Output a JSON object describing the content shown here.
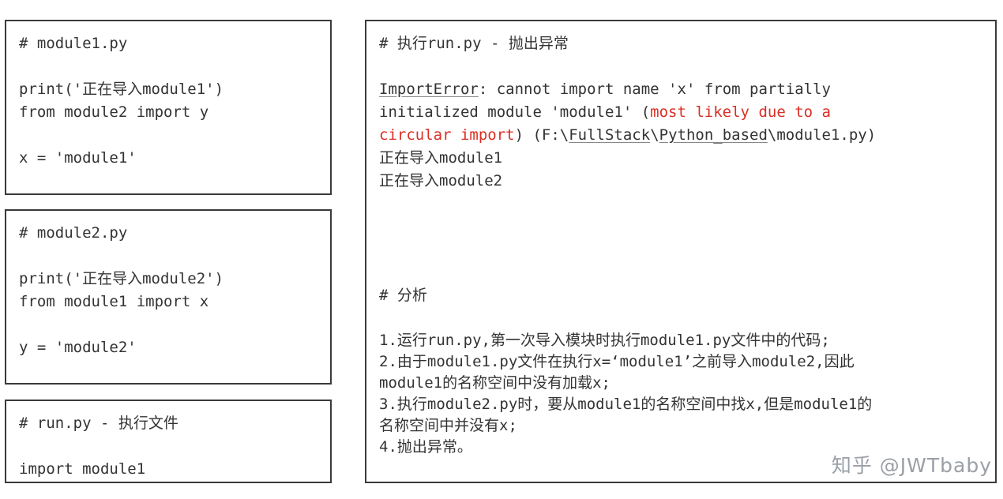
{
  "panels": {
    "module1": {
      "title": "# module1.py",
      "lines": [
        "print('正在导入module1')",
        "from module2 import y",
        "",
        "x = 'module1'"
      ],
      "full": "# module1.py\n\nprint('正在导入module1')\nfrom module2 import y\n\nx = 'module1'"
    },
    "module2": {
      "title": "# module2.py",
      "lines": [
        "print('正在导入module2')",
        "from module1 import x",
        "",
        "y = 'module2'"
      ],
      "full": "# module2.py\n\nprint('正在导入module2')\nfrom module1 import x\n\ny = 'module2'"
    },
    "run": {
      "title": "# run.py - 执行文件",
      "lines": [
        "import module1"
      ],
      "full": "# run.py - 执行文件\n\nimport module1"
    },
    "right": {
      "title": "# 执行run.py - 抛出异常",
      "error": {
        "name": "ImportError",
        "message_part1": ": cannot import name 'x' from partially",
        "message_part2": "initialized module 'module1' (",
        "highlight1": "most likely due to a",
        "highlight2": "circular import",
        "message_part3": ") (F:\\FullStack\\Python_based\\module1.py)",
        "path_segment1": "FullStack",
        "path_segment2": "Python_based"
      },
      "output_lines": [
        "正在导入module1",
        "正在导入module2"
      ],
      "analysis_title": "# 分析",
      "analysis_lines": [
        "1.运行run.py,第一次导入模块时执行module1.py文件中的代码;",
        "2.由于module1.py文件在执行x=‘module1’之前导入module2,因此",
        "module1的名称空间中没有加载x;",
        "3.执行module2.py时，要从module1的名称空间中找x,但是module1的",
        "名称空间中并没有x;",
        "4.抛出异常。"
      ]
    }
  },
  "watermark": {
    "logo": "知乎",
    "handle": "@JWTbaby"
  },
  "colors": {
    "border": "#3a3a3a",
    "text": "#333333",
    "error_highlight": "#d93025",
    "watermark": "#9aa0a6"
  }
}
